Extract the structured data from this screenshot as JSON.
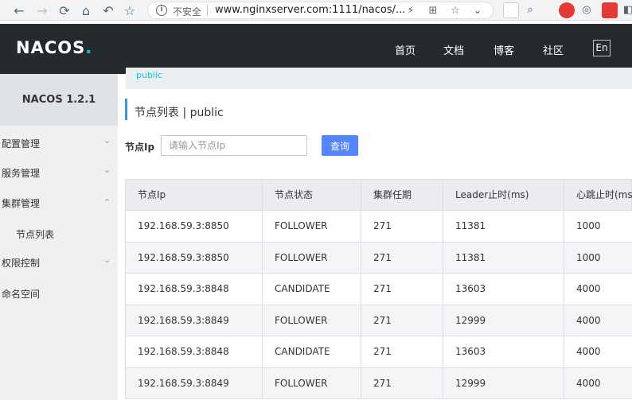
{
  "browser": {
    "insecure_label": "不安全",
    "url": "www.nginxserver.com:1111/nacos/..."
  },
  "header": {
    "logo_main": "NACOS",
    "logo_dot": ".",
    "nav": [
      "首页",
      "文档",
      "博客",
      "社区"
    ],
    "lang_button": "En"
  },
  "sidebar": {
    "version": "NACOS 1.2.1",
    "items": [
      {
        "label": "配置管理"
      },
      {
        "label": "服务管理"
      },
      {
        "label": "集群管理"
      },
      {
        "label": "节点列表"
      },
      {
        "label": "权限控制"
      },
      {
        "label": "命名空间"
      }
    ]
  },
  "content": {
    "breadcrumb": "public",
    "title": "节点列表  |  public",
    "search_label": "节点Ip",
    "search_placeholder": "请输入节点Ip",
    "search_button": "查询"
  },
  "table": {
    "headers": [
      "节点Ip",
      "节点状态",
      "集群任期",
      "Leader止时(ms)",
      "心跳止时(ms)"
    ],
    "rows": [
      [
        "192.168.59.3:8850",
        "FOLLOWER",
        "271",
        "11381",
        "1000"
      ],
      [
        "192.168.59.3:8850",
        "FOLLOWER",
        "271",
        "11381",
        "1000"
      ],
      [
        "192.168.59.3:8848",
        "CANDIDATE",
        "271",
        "13603",
        "4000"
      ],
      [
        "192.168.59.3:8849",
        "FOLLOWER",
        "271",
        "12999",
        "4000"
      ],
      [
        "192.168.59.3:8848",
        "CANDIDATE",
        "271",
        "13603",
        "4000"
      ],
      [
        "192.168.59.3:8849",
        "FOLLOWER",
        "271",
        "12999",
        "4000"
      ]
    ]
  },
  "colors": {
    "header_bg": "#252a2f",
    "accent": "#16c2d6",
    "primary_button": "#5584ff"
  }
}
